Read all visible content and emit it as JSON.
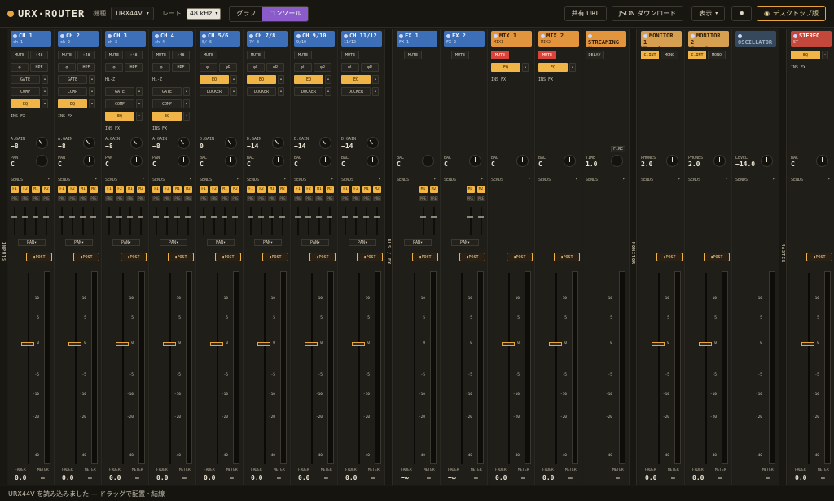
{
  "app": {
    "title": "URX·ROUTER",
    "device_label": "機種",
    "device_value": "URX44V",
    "rate_label": "レート",
    "rate_value": "48 kHz",
    "view_tabs": [
      {
        "label": "グラフ",
        "active": false
      },
      {
        "label": "コンソール",
        "active": true
      }
    ],
    "share_label": "共有 URL",
    "json_label": "JSON ダウンロード",
    "display_label": "表示",
    "desktop_label": "デスクトップ版",
    "accent": "#e9a53c",
    "tab_active_color": "#8b5cc9"
  },
  "sections": {
    "inputs": "INPUTS",
    "busfx": "BUS / FX",
    "monitor": "MONITOR",
    "master": "MASTER"
  },
  "labels": {
    "sends": "SENDS",
    "pan": "PAN",
    "post": "POST",
    "fader": "FADER",
    "meter": "METER",
    "scale": [
      "10",
      "5",
      "0",
      "-5",
      "-10",
      "-20",
      "-40",
      "-∞"
    ]
  },
  "status": "URX44V を読み込みました — ドラッグで配置・結線",
  "strips": [
    {
      "name": "CH 1",
      "sub": "ch 1",
      "color": "blue",
      "rows": [
        [
          "MUTE",
          "+48"
        ],
        [
          "φ",
          "HPF"
        ],
        [
          "GATE",
          "•"
        ],
        [
          "COMP",
          "•"
        ],
        [
          "EQ*",
          "•"
        ],
        [
          "INS FX"
        ]
      ],
      "k1l": "A.GAIN",
      "k1v": "−8",
      "k2l": "PAN",
      "k2v": "C",
      "sends": [
        "F1",
        "F2",
        "M1",
        "M2"
      ],
      "fader": "0.0",
      "meter": "—"
    },
    {
      "name": "CH 2",
      "sub": "ch 2",
      "color": "blue",
      "rows": [
        [
          "MUTE",
          "+48"
        ],
        [
          "φ",
          "HPF"
        ],
        [
          "GATE",
          "•"
        ],
        [
          "COMP",
          "•"
        ],
        [
          "EQ*",
          "•"
        ],
        [
          "INS FX"
        ]
      ],
      "k1l": "A.GAIN",
      "k1v": "−8",
      "k2l": "PAN",
      "k2v": "C",
      "sends": [
        "F1",
        "F2",
        "M1",
        "M2"
      ],
      "fader": "0.0",
      "meter": "—"
    },
    {
      "name": "CH 3",
      "sub": "ch 3",
      "color": "blue",
      "rows": [
        [
          "MUTE",
          "+48"
        ],
        [
          "φ",
          "HPF"
        ],
        [
          "Hi-Z"
        ],
        [
          "GATE",
          "•"
        ],
        [
          "COMP",
          "•"
        ],
        [
          "EQ*",
          "•"
        ],
        [
          "INS FX"
        ]
      ],
      "k1l": "A.GAIN",
      "k1v": "−8",
      "k2l": "PAN",
      "k2v": "C",
      "sends": [
        "F1",
        "F2",
        "M1",
        "M2"
      ],
      "fader": "0.0",
      "meter": "—"
    },
    {
      "name": "CH 4",
      "sub": "ch 4",
      "color": "blue",
      "rows": [
        [
          "MUTE",
          "+48"
        ],
        [
          "φ",
          "HPF"
        ],
        [
          "Hi-Z"
        ],
        [
          "GATE",
          "•"
        ],
        [
          "COMP",
          "•"
        ],
        [
          "EQ*",
          "•"
        ],
        [
          "INS FX"
        ]
      ],
      "k1l": "A.GAIN",
      "k1v": "−8",
      "k2l": "PAN",
      "k2v": "C",
      "sends": [
        "F1",
        "F2",
        "M1",
        "M2"
      ],
      "fader": "0.0",
      "meter": "—"
    },
    {
      "name": "CH 5/6",
      "sub": "5/ 6",
      "color": "blue",
      "rows": [
        [
          "MUTE"
        ],
        [
          "φL",
          "φR"
        ],
        [
          "EQ*",
          "•"
        ],
        [
          "DUCKER",
          "•"
        ]
      ],
      "k1l": "D.GAIN",
      "k1v": "0",
      "k2l": "BAL",
      "k2v": "C",
      "sends": [
        "F1",
        "F2",
        "M1",
        "M2"
      ],
      "fader": "0.0",
      "meter": "—"
    },
    {
      "name": "CH 7/8",
      "sub": "7/ 8",
      "color": "blue",
      "rows": [
        [
          "MUTE"
        ],
        [
          "φL",
          "φR"
        ],
        [
          "EQ*",
          "•"
        ],
        [
          "DUCKER",
          "•"
        ]
      ],
      "k1l": "D.GAIN",
      "k1v": "−14",
      "k2l": "BAL",
      "k2v": "C",
      "sends": [
        "F1",
        "F2",
        "M1",
        "M2"
      ],
      "fader": "0.0",
      "meter": "—"
    },
    {
      "name": "CH 9/10",
      "sub": "9/10",
      "color": "blue",
      "rows": [
        [
          "MUTE"
        ],
        [
          "φL",
          "φR"
        ],
        [
          "EQ*",
          "•"
        ],
        [
          "DUCKER",
          "•"
        ]
      ],
      "k1l": "D.GAIN",
      "k1v": "−14",
      "k2l": "BAL",
      "k2v": "C",
      "sends": [
        "F1",
        "F2",
        "M1",
        "M2"
      ],
      "fader": "0.0",
      "meter": "—"
    },
    {
      "name": "CH 11/12",
      "sub": "11/12",
      "color": "blue",
      "rows": [
        [
          "MUTE"
        ],
        [
          "φL",
          "φR"
        ],
        [
          "EQ*",
          "•"
        ],
        [
          "DUCKER",
          "•"
        ]
      ],
      "k1l": "D.GAIN",
      "k1v": "−14",
      "k2l": "BAL",
      "k2v": "C",
      "sends": [
        "F1",
        "F2",
        "M1",
        "M2"
      ],
      "fader": "0.0",
      "meter": "—"
    },
    {
      "name": "FX 1",
      "sub": "FX 1",
      "color": "blue",
      "rows": [
        [
          "MUTE"
        ]
      ],
      "k1l": "",
      "k1v": "",
      "k2l": "BAL",
      "k2v": "C",
      "sends": [
        "M1",
        "M2"
      ],
      "fader": "−∞",
      "meter": "—"
    },
    {
      "name": "FX 2",
      "sub": "FX 2",
      "color": "blue",
      "rows": [
        [
          "MUTE"
        ]
      ],
      "k1l": "",
      "k1v": "",
      "k2l": "BAL",
      "k2v": "C",
      "sends": [
        "M1",
        "M2"
      ],
      "fader": "−∞",
      "meter": "—"
    },
    {
      "name": "MIX 1",
      "sub": "MIX1",
      "color": "orange",
      "rows": [
        [
          "MUTE!"
        ],
        [
          "EQ*",
          "•"
        ],
        [
          "INS FX"
        ]
      ],
      "k1l": "",
      "k1v": "",
      "k2l": "BAL",
      "k2v": "C",
      "sends": [],
      "fader": "0.0",
      "meter": "—"
    },
    {
      "name": "MIX 2",
      "sub": "MIX2",
      "color": "orange",
      "rows": [
        [
          "MUTE!"
        ],
        [
          "EQ*",
          "•"
        ],
        [
          "INS FX"
        ]
      ],
      "k1l": "",
      "k1v": "",
      "k2l": "BAL",
      "k2v": "C",
      "sends": [],
      "fader": "0.0",
      "meter": "—"
    },
    {
      "name": "STREAMING",
      "sub": "Strm",
      "color": "orange",
      "rows": [
        [
          "DELAY"
        ]
      ],
      "k1l": "",
      "k1v": "",
      "k2l": "TIME",
      "k2v": "1.0",
      "fine": "FINE",
      "sends": [],
      "fader": "",
      "meter": "—"
    },
    {
      "name": "MONITOR 1",
      "sub": "Phone 1",
      "color": "tan",
      "rows": [
        [
          "C.INT*",
          "MONO"
        ]
      ],
      "k1l": "",
      "k1v": "",
      "k2l": "PHONES",
      "k2v": "2.0",
      "sends": [],
      "fader": "0.0",
      "meter": "—"
    },
    {
      "name": "MONITOR 2",
      "sub": "Phone 2",
      "color": "tan",
      "rows": [
        [
          "C.INT*",
          "MONO"
        ]
      ],
      "k1l": "",
      "k1v": "",
      "k2l": "PHONES",
      "k2v": "2.0",
      "sends": [],
      "fader": "0.0",
      "meter": "—"
    },
    {
      "name": "OSCILLATOR",
      "sub": "",
      "color": "grey",
      "rows": [],
      "k1l": "",
      "k1v": "",
      "k2l": "LEVEL",
      "k2v": "−14.0",
      "sends": [],
      "fader": "",
      "meter": "—"
    },
    {
      "name": "STEREO",
      "sub": "ST",
      "color": "red",
      "rows": [
        [
          "EQ*",
          "•"
        ],
        [
          "INS FX"
        ]
      ],
      "k1l": "",
      "k1v": "",
      "k2l": "BAL",
      "k2v": "C",
      "sends": [],
      "fader": "0.0",
      "meter": "—"
    }
  ]
}
